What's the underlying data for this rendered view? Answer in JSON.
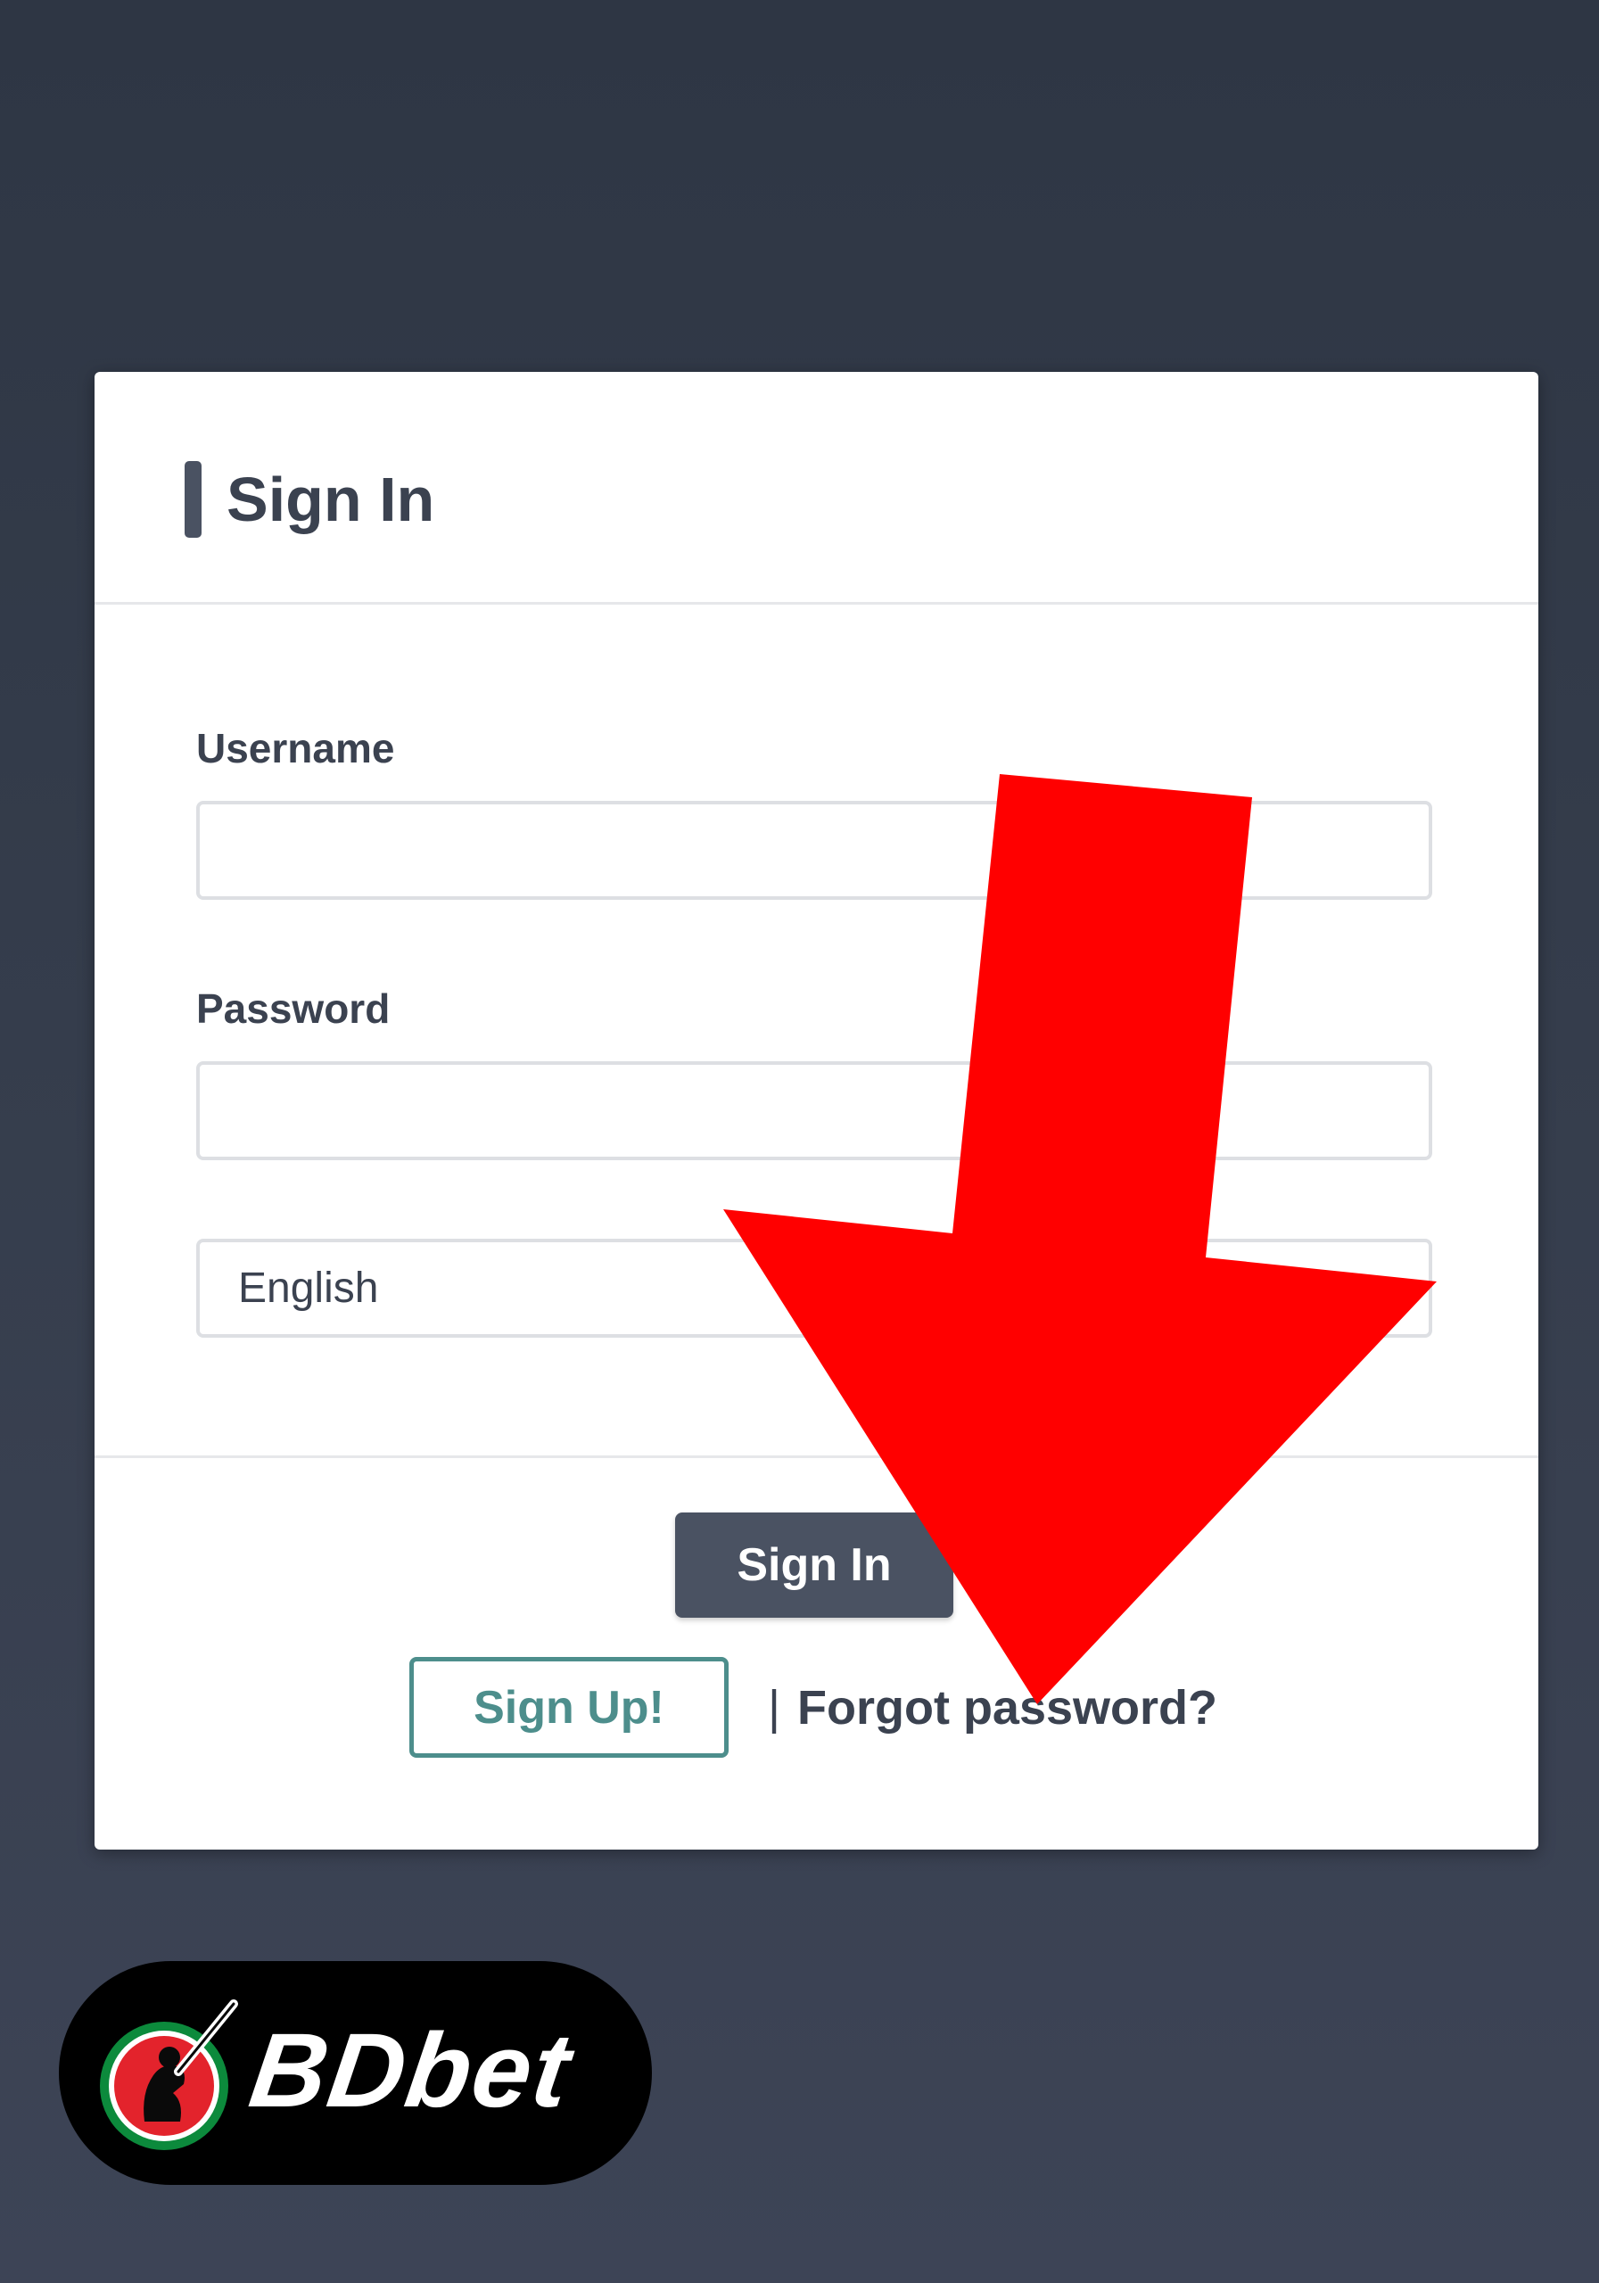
{
  "card": {
    "title": "Sign In",
    "username_label": "Username",
    "username_value": "",
    "password_label": "Password",
    "password_value": "",
    "language_selected": "English",
    "signin_button": "Sign In",
    "signup_button": "Sign Up!",
    "separator": "|",
    "forgot_link": "Forgot password?"
  },
  "overlay": {
    "arrow_color": "#ff0000"
  },
  "logo": {
    "text": "BDbet",
    "icon": "cricket-batsman-icon"
  },
  "colors": {
    "background": "#333b4a",
    "primary_button": "#4a5262",
    "signup_accent": "#4d8e8c"
  }
}
